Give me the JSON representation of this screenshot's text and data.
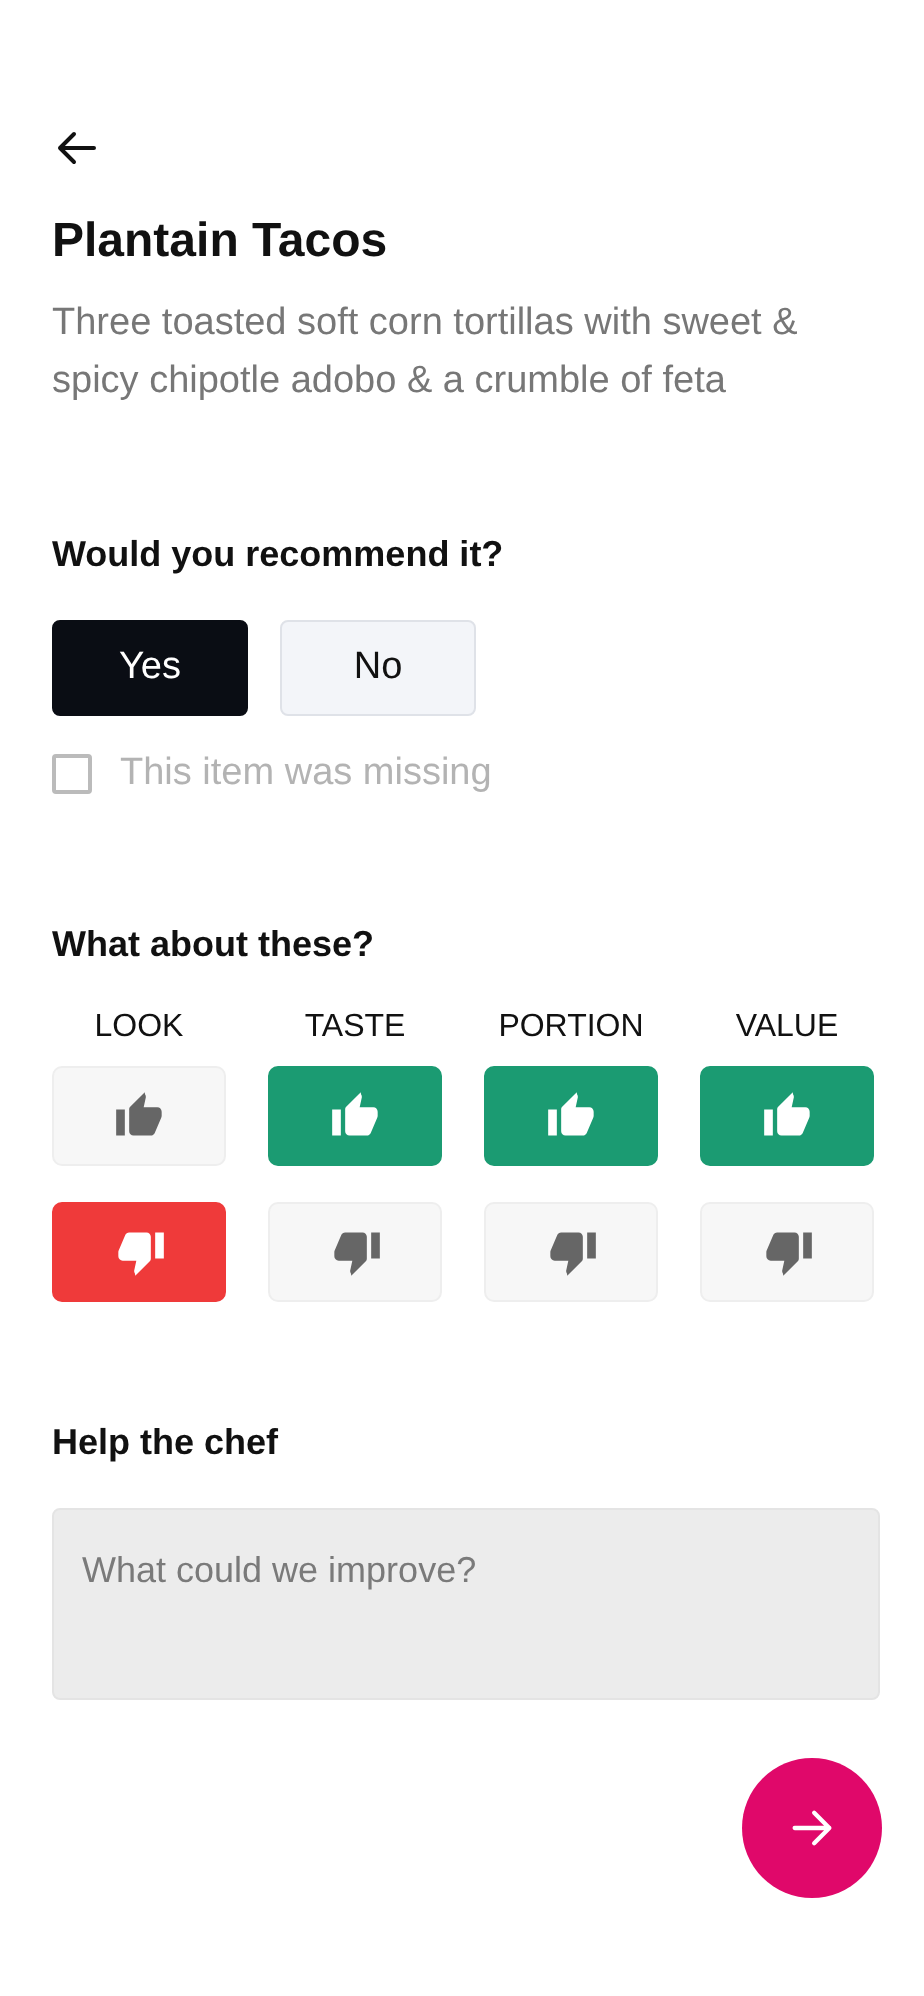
{
  "title": "Plantain Tacos",
  "description": "Three toasted soft corn tortillas with sweet & spicy chipotle adobo & a crumble of feta",
  "recommend": {
    "question": "Would you recommend it?",
    "options": [
      {
        "label": "Yes",
        "selected": true
      },
      {
        "label": "No",
        "selected": false
      }
    ]
  },
  "missing": {
    "label": "This item was missing",
    "checked": false,
    "disabled": true
  },
  "aspects_heading": "What about these?",
  "aspects": [
    {
      "label": "LOOK",
      "up": {
        "selected": false
      },
      "down": {
        "selected": true
      }
    },
    {
      "label": "TASTE",
      "up": {
        "selected": true
      },
      "down": {
        "selected": false
      }
    },
    {
      "label": "PORTION",
      "up": {
        "selected": true
      },
      "down": {
        "selected": false
      }
    },
    {
      "label": "VALUE",
      "up": {
        "selected": true
      },
      "down": {
        "selected": false
      }
    }
  ],
  "feedback": {
    "heading": "Help the chef",
    "placeholder": "What could we improve?"
  }
}
